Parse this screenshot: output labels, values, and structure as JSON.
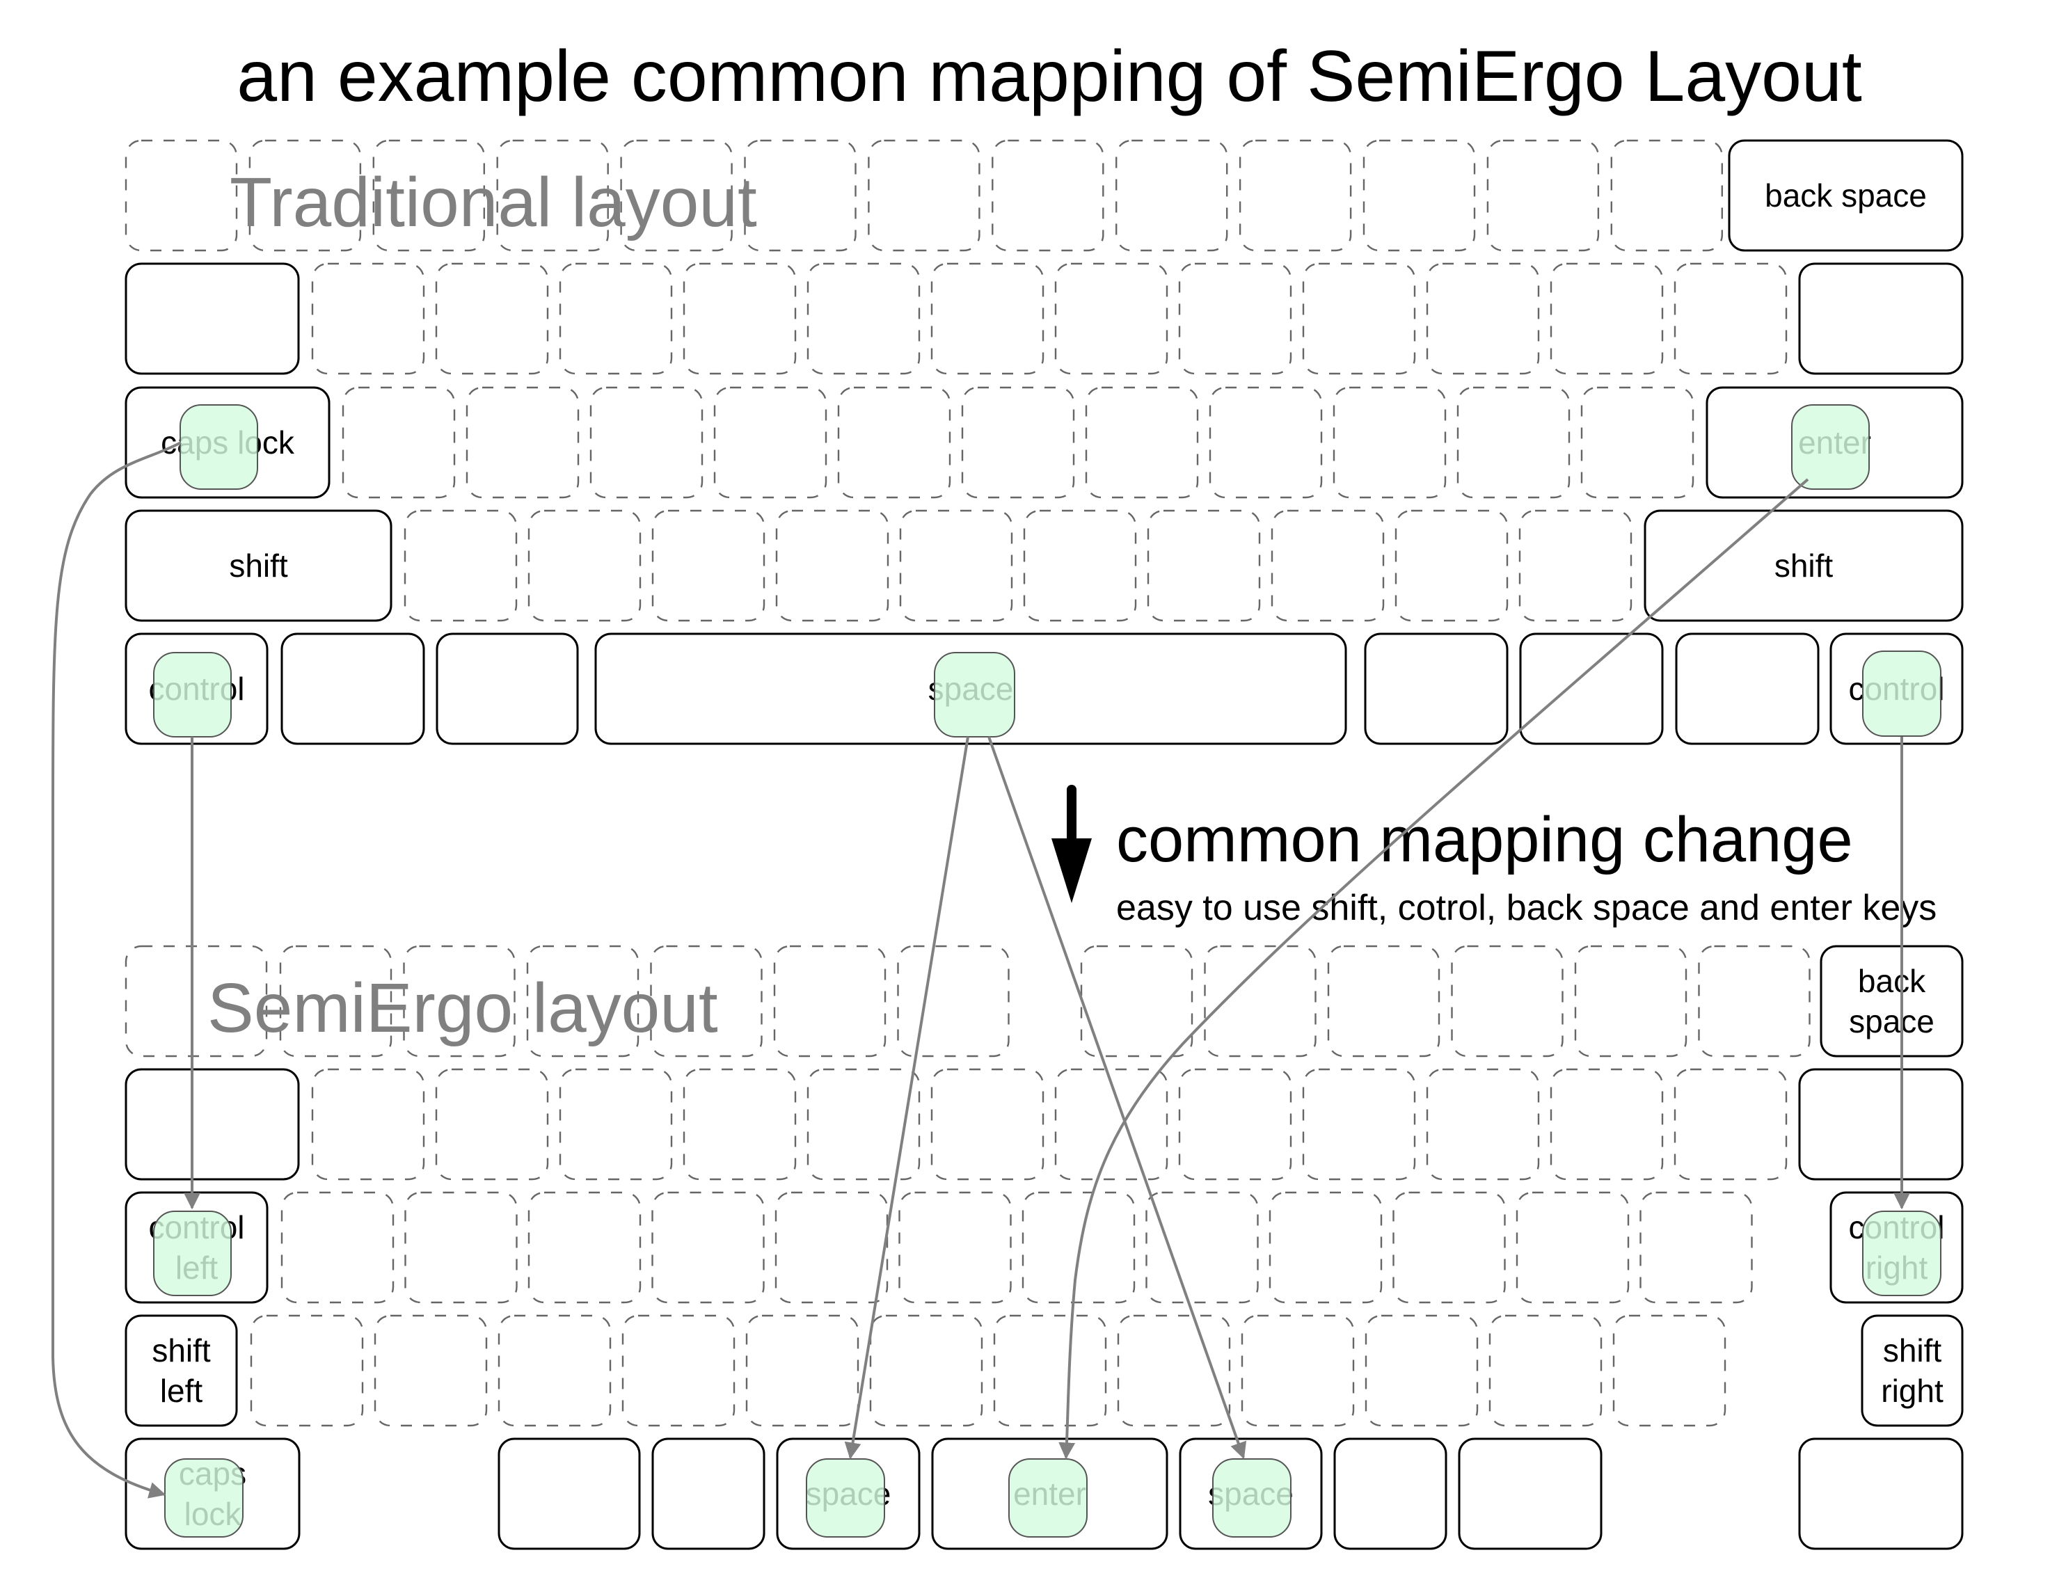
{
  "title": "an example common mapping of SemiErgo Layout",
  "sections": {
    "traditional": "Traditional layout",
    "semiergo": "SemiErgo layout"
  },
  "change": {
    "heading": "common mapping change",
    "subtitle": "easy to use shift, cotrol, back space and enter keys",
    "arrow_icon": "down-arrow-icon"
  },
  "colors": {
    "highlight": "#d5fbdf",
    "link": "#808080",
    "section_label": "#808080"
  },
  "traditional_keys": {
    "backspace": [
      "back space"
    ],
    "caps_lock": [
      "caps lock"
    ],
    "enter": [
      "enter"
    ],
    "shift_left": [
      "shift"
    ],
    "shift_right": [
      "shift"
    ],
    "control_left": [
      "control"
    ],
    "space": [
      "space"
    ],
    "control_right": [
      "control"
    ]
  },
  "semiergo_keys": {
    "backspace": [
      "back",
      "space"
    ],
    "control_left": [
      "control",
      "left"
    ],
    "control_right": [
      "control",
      "right"
    ],
    "shift_left": [
      "shift",
      "left"
    ],
    "shift_right": [
      "shift",
      "right"
    ],
    "caps_lock": [
      "caps",
      "lock"
    ],
    "space_left": [
      "space"
    ],
    "enter": [
      "enter"
    ],
    "space_right": [
      "space"
    ]
  },
  "mappings": [
    {
      "from": "traditional.caps_lock",
      "to": "semiergo.caps_lock"
    },
    {
      "from": "traditional.control_left",
      "to": "semiergo.control_left"
    },
    {
      "from": "traditional.space",
      "to": "semiergo.space_left"
    },
    {
      "from": "traditional.space",
      "to": "semiergo.space_right"
    },
    {
      "from": "traditional.enter",
      "to": "semiergo.enter"
    },
    {
      "from": "traditional.control_right",
      "to": "semiergo.control_right"
    }
  ]
}
